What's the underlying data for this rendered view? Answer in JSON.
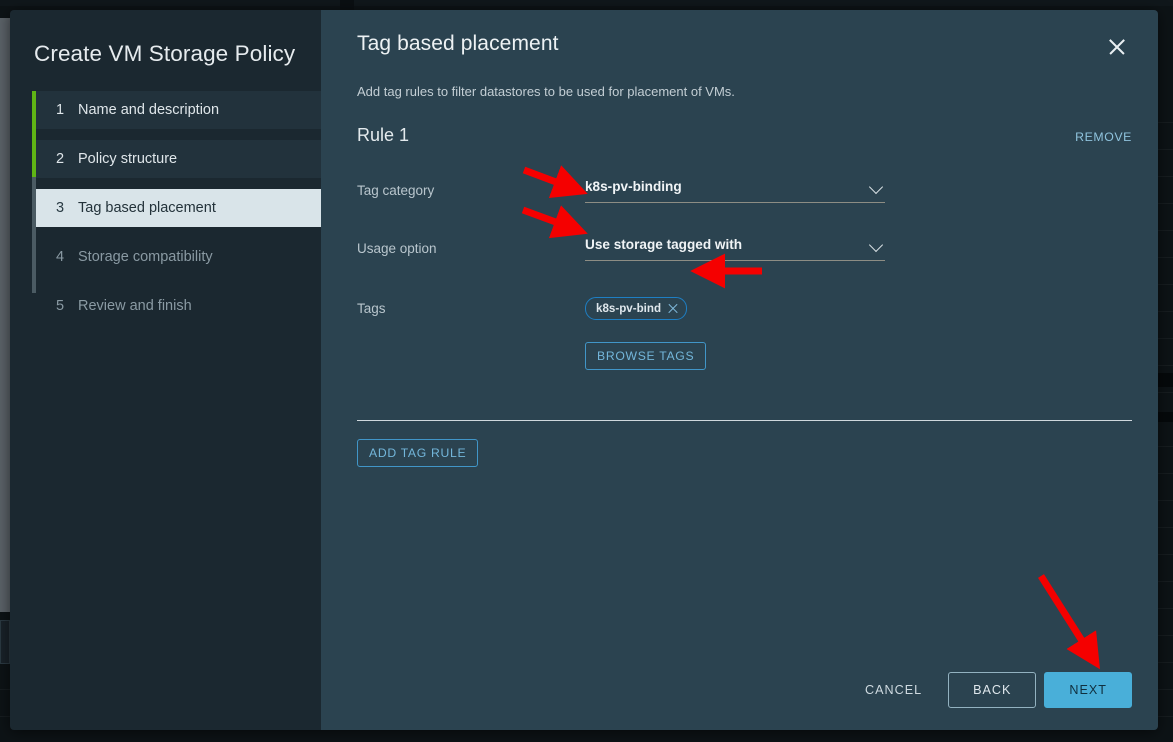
{
  "dialog": {
    "title": "Create VM Storage Policy",
    "steps": [
      {
        "num": "1",
        "label": "Name and description",
        "state": "visited"
      },
      {
        "num": "2",
        "label": "Policy structure",
        "state": "visited"
      },
      {
        "num": "3",
        "label": "Tag based placement",
        "state": "current"
      },
      {
        "num": "4",
        "label": "Storage compatibility",
        "state": "future"
      },
      {
        "num": "5",
        "label": "Review and finish",
        "state": "future"
      }
    ]
  },
  "content": {
    "title": "Tag based placement",
    "close_icon": "close-icon",
    "subtitle": "Add tag rules to filter datastores to be used for placement of VMs.",
    "rule": {
      "title": "Rule 1",
      "remove_label": "REMOVE",
      "fields": {
        "tag_category_label": "Tag category",
        "tag_category_value": "k8s-pv-binding",
        "usage_option_label": "Usage option",
        "usage_option_value": "Use storage tagged with",
        "tags_label": "Tags",
        "tag_chip": "k8s-pv-bind",
        "tag_chip_remove_icon": "close-icon",
        "browse_tags_label": "BROWSE TAGS"
      }
    },
    "add_tag_rule_label": "ADD TAG RULE"
  },
  "footer": {
    "cancel_label": "CANCEL",
    "back_label": "BACK",
    "next_label": "NEXT"
  },
  "colors": {
    "accent_blue": "#49afd9",
    "progress_green": "#60b515",
    "annotation_red": "#f50000",
    "sidebar_bg": "#1b2830",
    "content_bg": "#2b4350",
    "current_step_bg": "#d9e4e9"
  },
  "annotations": {
    "arrow_tag_category": "red-arrow-icon",
    "arrow_usage_option": "red-arrow-icon",
    "arrow_tags_chip": "red-arrow-icon",
    "arrow_next_button": "red-arrow-icon"
  }
}
